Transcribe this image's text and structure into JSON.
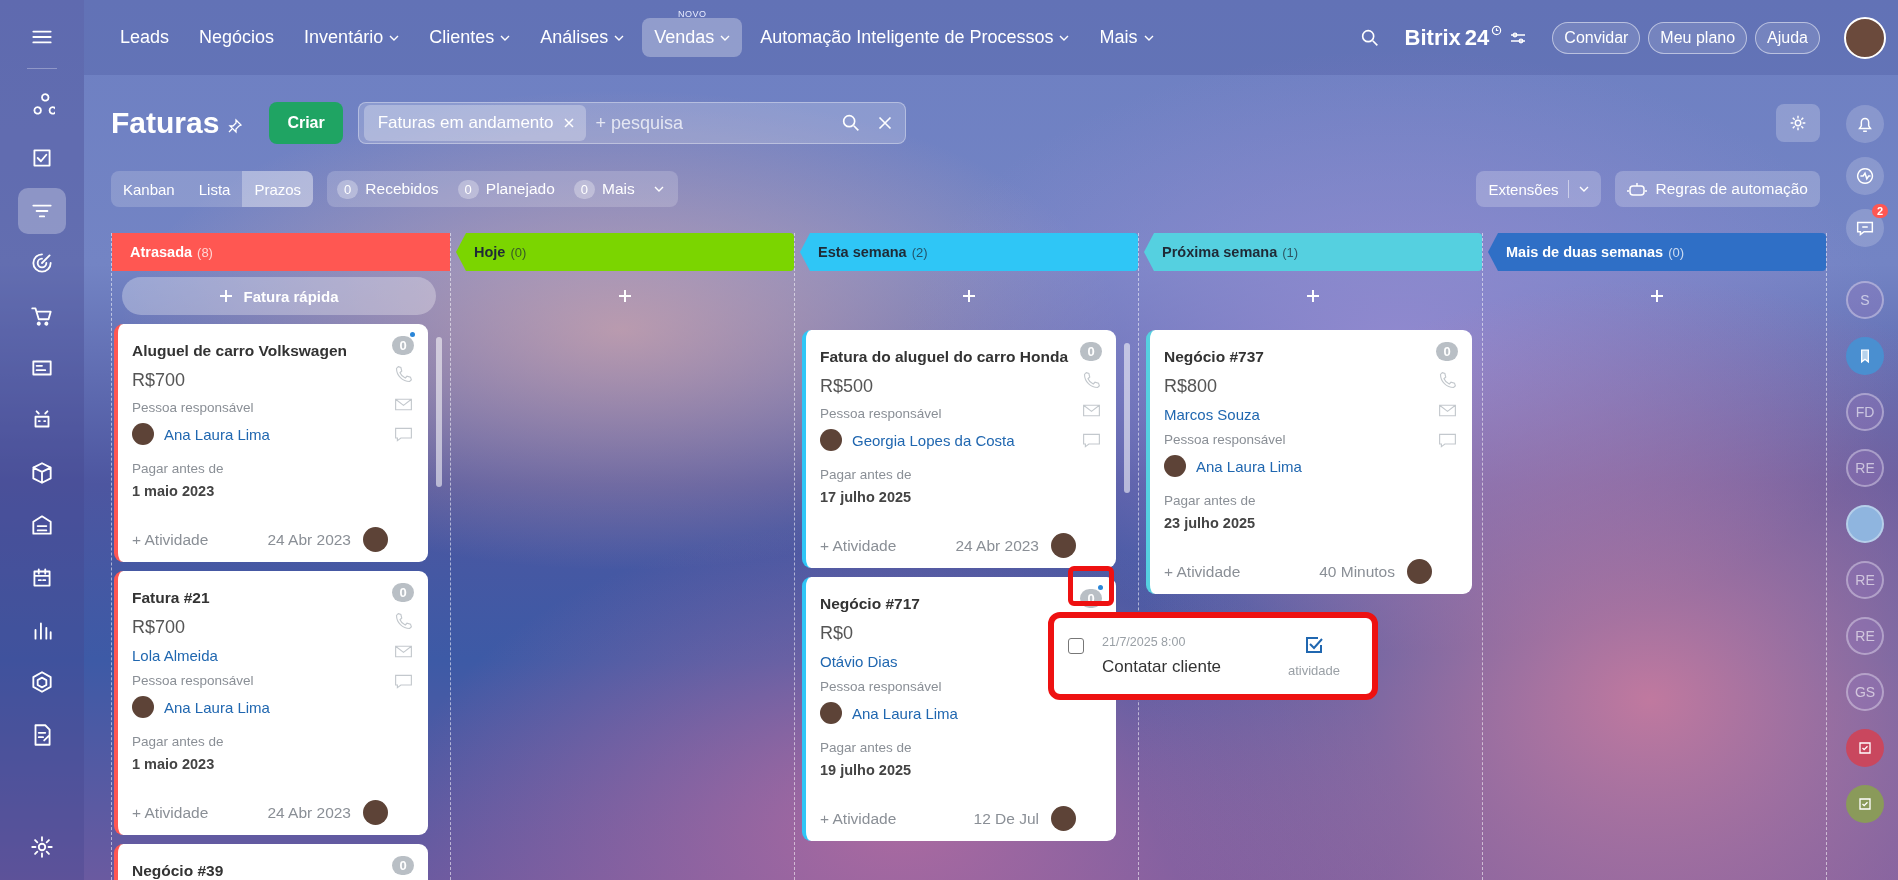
{
  "sidebar": {
    "items": [
      {
        "selected": false
      },
      {
        "selected": false
      },
      {
        "selected": true
      },
      {
        "selected": false
      },
      {
        "selected": false
      },
      {
        "selected": false
      },
      {
        "selected": false
      },
      {
        "selected": false
      },
      {
        "selected": false
      },
      {
        "selected": false
      },
      {
        "selected": false
      },
      {
        "selected": false
      },
      {
        "selected": false
      }
    ]
  },
  "top_nav": {
    "items": [
      {
        "label": "Leads",
        "selected": false,
        "dropdown": false
      },
      {
        "label": "Negócios",
        "selected": false,
        "dropdown": false
      },
      {
        "label": "Inventário",
        "selected": false,
        "dropdown": true
      },
      {
        "label": "Clientes",
        "selected": false,
        "dropdown": true
      },
      {
        "label": "Análises",
        "selected": false,
        "dropdown": true
      },
      {
        "label": "Vendas",
        "selected": true,
        "dropdown": true,
        "badge": "NOVO"
      },
      {
        "label": "Automação Inteligente de Processos",
        "selected": false,
        "dropdown": true
      },
      {
        "label": "Mais",
        "selected": false,
        "dropdown": true
      }
    ],
    "logo": "Bitrix",
    "logo_suffix": "24",
    "buttons": [
      "Convidar",
      "Meu plano",
      "Ajuda"
    ]
  },
  "header": {
    "title": "Faturas",
    "create_button": "Criar",
    "filter_chip": "Faturas em andamento",
    "search": {
      "placeholder": "+ pesquisa"
    }
  },
  "view_tabs": [
    {
      "label": "Kanban",
      "selected": false
    },
    {
      "label": "Lista",
      "selected": false
    },
    {
      "label": "Prazos",
      "selected": true
    }
  ],
  "counters": [
    {
      "count": "0",
      "label": "Recebidos"
    },
    {
      "count": "0",
      "label": "Planejado"
    },
    {
      "count": "0",
      "label": "Mais",
      "dropdown": true
    }
  ],
  "toolbar_buttons": {
    "extensions": "Extensões",
    "automation": "Regras de automação"
  },
  "columns": [
    {
      "title": "Atrasada",
      "count": "(8)",
      "color": "#ff5752",
      "quick_add": "Fatura rápida",
      "scrollbar": true,
      "cards": [
        {
          "title": "Aluguel de carro Volkswagen",
          "badge": "0",
          "unread": true,
          "amount": "R$700",
          "responsible_label": "Pessoa responsável",
          "responsible": "Ana Laura Lima",
          "due_label": "Pagar antes de",
          "due_date": "1 maio 2023",
          "activity": "+ Atividade",
          "date": "24 Abr 2023"
        },
        {
          "title": "Fatura #21",
          "badge": "0",
          "unread": false,
          "amount": "R$700",
          "contact": "Lola Almeida",
          "responsible_label": "Pessoa responsável",
          "responsible": "Ana Laura Lima",
          "due_label": "Pagar antes de",
          "due_date": "1 maio 2023",
          "activity": "+ Atividade",
          "date": "24 Abr 2023"
        },
        {
          "title": "Negócio #39",
          "badge": "0",
          "unread": false
        }
      ]
    },
    {
      "title": "Hoje",
      "count": "(0)",
      "color": "#7bd500",
      "scrollbar": false
    },
    {
      "title": "Esta semana",
      "count": "(2)",
      "color": "#2fc6f6",
      "scrollbar": true,
      "cards": [
        {
          "title": "Fatura do aluguel do carro Honda",
          "badge": "0",
          "unread": false,
          "amount": "R$500",
          "responsible_label": "Pessoa responsável",
          "responsible": "Georgia Lopes da Costa",
          "due_label": "Pagar antes de",
          "due_date": "17 julho 2025",
          "activity": "+ Atividade",
          "date": "24 Abr 2023"
        },
        {
          "title": "Negócio #717",
          "badge": "0",
          "unread": true,
          "amount": "R$0",
          "contact": "Otávio Dias",
          "responsible_label": "Pessoa responsável",
          "responsible": "Ana Laura Lima",
          "due_label": "Pagar antes de",
          "due_date": "19 julho 2025",
          "activity": "+ Atividade",
          "date": "12 De Jul"
        }
      ]
    },
    {
      "title": "Próxima semana",
      "count": "(1)",
      "color": "#55d0e0",
      "scrollbar": false,
      "cards": [
        {
          "title": "Negócio #737",
          "badge": "0",
          "unread": false,
          "amount": "R$800",
          "contact": "Marcos Souza",
          "responsible_label": "Pessoa responsável",
          "responsible": "Ana Laura Lima",
          "due_label": "Pagar antes de",
          "due_date": "23 julho 2025",
          "activity": "+ Atividade",
          "date": "40 Minutos"
        }
      ]
    },
    {
      "title": "Mais de duas semanas",
      "count": "(0)",
      "color": "#2f6fc6",
      "scrollbar": false
    }
  ],
  "activity_popup": {
    "checked": false,
    "datetime": "21/7/2025 8:00",
    "title": "Contatar cliente",
    "action": "atividade"
  },
  "right_rail": {
    "items": [
      {
        "kind": "bell"
      },
      {
        "kind": "pulse"
      },
      {
        "kind": "chat",
        "badge": "2"
      }
    ],
    "contacts": [
      {
        "kind": "initials",
        "text": "S"
      },
      {
        "kind": "bookmark"
      },
      {
        "kind": "initials",
        "text": "FD"
      },
      {
        "kind": "initials",
        "text": "RE"
      },
      {
        "kind": "avatar"
      },
      {
        "kind": "initials",
        "text": "RE"
      },
      {
        "kind": "initials",
        "text": "RE"
      },
      {
        "kind": "initials",
        "text": "GS"
      },
      {
        "kind": "task",
        "color": "#c9475e"
      },
      {
        "kind": "task",
        "color": "#8a9a5a"
      }
    ]
  }
}
